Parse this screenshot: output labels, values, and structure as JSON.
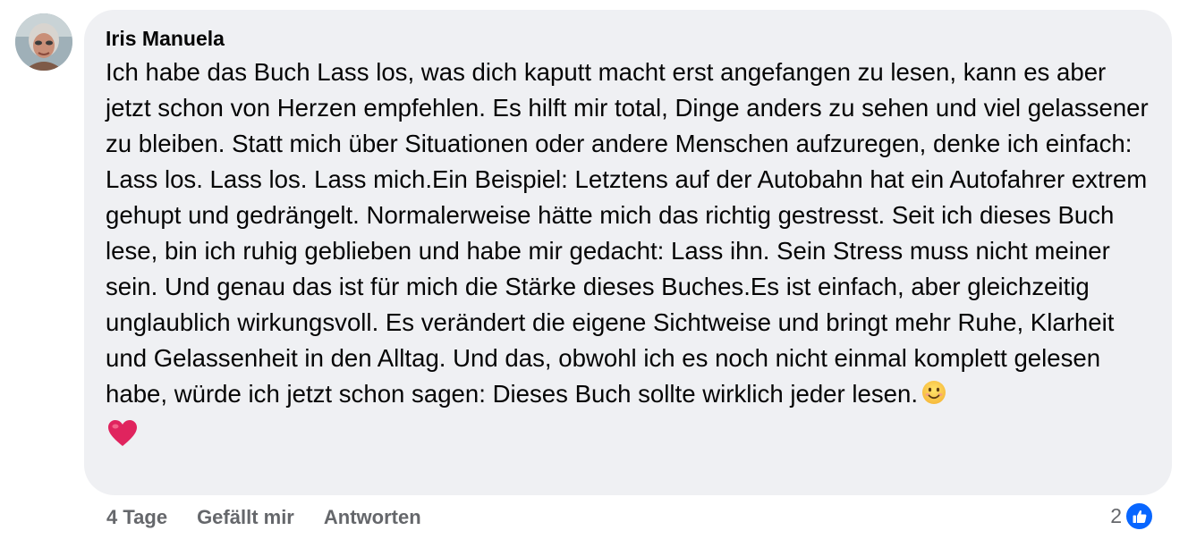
{
  "comment": {
    "author": "Iris Manuela",
    "text": "Ich habe das Buch Lass los, was dich kaputt macht erst angefangen zu lesen, kann es aber jetzt schon von Herzen empfehlen. Es hilft mir total, Dinge anders zu sehen und viel gelassener zu bleiben. Statt mich über Situationen oder andere Menschen aufzuregen, denke ich einfach: Lass los. Lass los. Lass mich.Ein Beispiel: Letztens auf der Autobahn hat ein Autofahrer extrem gehupt und gedrängelt. Normalerweise hätte mich das richtig gestresst. Seit ich dieses Buch lese, bin ich ruhig geblieben und habe mir gedacht: Lass ihn. Sein Stress muss nicht meiner sein. Und genau das ist für mich die Stärke dieses Buches.Es ist einfach, aber gleichzeitig unglaublich wirkungsvoll. Es verändert die eigene Sichtweise und bringt mehr Ruhe, Klarheit und Gelassenheit in den Alltag. Und das, obwohl ich es noch nicht einmal komplett gelesen habe, würde ich jetzt schon sagen: Dieses Buch sollte wirklich jeder lesen.",
    "emojis": [
      "smiling-face-icon",
      "red-heart-icon"
    ],
    "timestamp": "4 Tage",
    "like_label": "Gefällt mir",
    "reply_label": "Antworten",
    "reaction_count": "2",
    "reaction_icon": "like-icon"
  },
  "colors": {
    "bubble_bg": "#eff0f3",
    "text": "#050505",
    "meta": "#65676b",
    "like_blue": "#0866ff",
    "heart_red": "#e0245e"
  }
}
